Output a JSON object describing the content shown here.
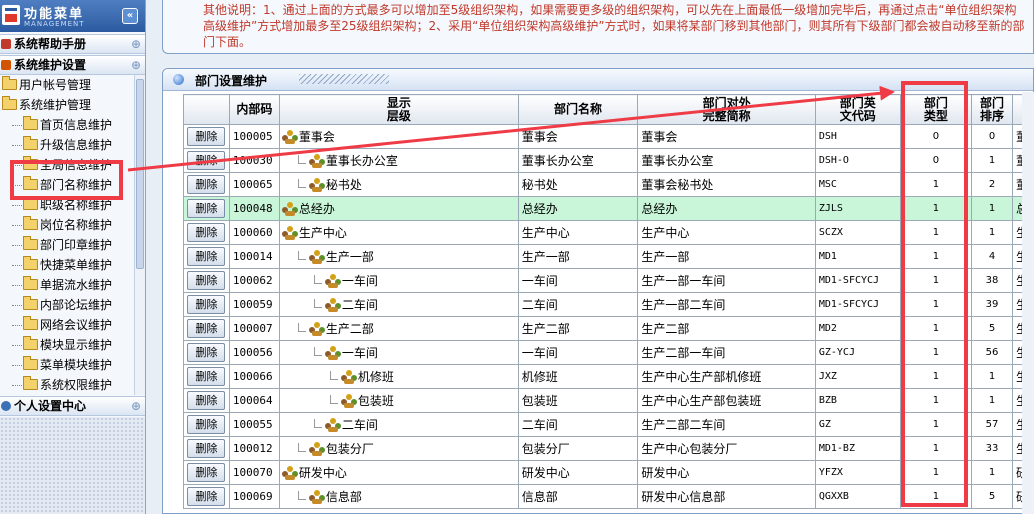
{
  "sidebar": {
    "title": "功能菜单",
    "subtitle": "MANAGEMENT",
    "collapse_glyph": "«",
    "sections": {
      "help": "系统帮助手册",
      "system": "系统维护设置",
      "personal": "个人设置中心"
    },
    "toggle_glyph": "⊕",
    "tree": [
      {
        "label": "用户帐号管理",
        "depth": 0
      },
      {
        "label": "系统维护管理",
        "depth": 0
      },
      {
        "label": "首页信息维护",
        "depth": 1
      },
      {
        "label": "升级信息维护",
        "depth": 1
      },
      {
        "label": "全局信息维护",
        "depth": 1
      },
      {
        "label": "部门名称维护",
        "depth": 1
      },
      {
        "label": "职级名称维护",
        "depth": 1
      },
      {
        "label": "岗位名称维护",
        "depth": 1
      },
      {
        "label": "部门印章维护",
        "depth": 1
      },
      {
        "label": "快捷菜单维护",
        "depth": 1
      },
      {
        "label": "单据流水维护",
        "depth": 1
      },
      {
        "label": "内部论坛维护",
        "depth": 1
      },
      {
        "label": "网络会议维护",
        "depth": 1
      },
      {
        "label": "模块显示维护",
        "depth": 1
      },
      {
        "label": "菜单模块维护",
        "depth": 1
      },
      {
        "label": "系统权限维护",
        "depth": 1
      }
    ]
  },
  "notice": {
    "label": "其他说明：",
    "text": "1、通过上面的方式最多可以增加至5级组织架构，如果需要更多级的组织架构，可以先在上面最低一级增加完毕后，再通过点击“单位组织架构高级维护”方式增加最多至25级组织架构；2、采用“单位组织架构高级维护”方式时，如果将某部门移到其他部门，则其所有下级部门都会被自动移至新的部门下面。"
  },
  "panel": {
    "title": "部门设置维护"
  },
  "table": {
    "headers": {
      "action": "",
      "id": "内部码",
      "level": "显示\n层级",
      "name": "部门名称",
      "fullname": "部门对外\n完整简称",
      "abbr": "部门英\n文代码",
      "type": "部门\n类型",
      "order": "部门\n排序",
      "extra": ""
    },
    "delete_label": "删除",
    "rows": [
      {
        "id": "100005",
        "level": "董事会",
        "depth": 0,
        "name": "董事会",
        "fullname": "董事会",
        "abbr": "DSH",
        "type": "0",
        "order": "0",
        "extra": "董"
      },
      {
        "id": "100030",
        "level": "董事长办公室",
        "depth": 1,
        "name": "董事长办公室",
        "fullname": "董事长办公室",
        "abbr": "DSH-O",
        "type": "0",
        "order": "1",
        "extra": "董"
      },
      {
        "id": "100065",
        "level": "秘书处",
        "depth": 1,
        "name": "秘书处",
        "fullname": "董事会秘书处",
        "abbr": "MSC",
        "type": "1",
        "order": "2",
        "extra": "董"
      },
      {
        "id": "100048",
        "level": "总经办",
        "depth": 0,
        "name": "总经办",
        "fullname": "总经办",
        "abbr": "ZJLS",
        "type": "1",
        "order": "1",
        "extra": "总",
        "selected": true
      },
      {
        "id": "100060",
        "level": "生产中心",
        "depth": 0,
        "name": "生产中心",
        "fullname": "生产中心",
        "abbr": "SCZX",
        "type": "1",
        "order": "1",
        "extra": "生"
      },
      {
        "id": "100014",
        "level": "生产一部",
        "depth": 1,
        "name": "生产一部",
        "fullname": "生产一部",
        "abbr": "MD1",
        "type": "1",
        "order": "4",
        "extra": "生"
      },
      {
        "id": "100062",
        "level": "一车间",
        "depth": 2,
        "name": "一车间",
        "fullname": "生产一部一车间",
        "abbr": "MD1-SFCYCJ",
        "type": "1",
        "order": "38",
        "extra": "生"
      },
      {
        "id": "100059",
        "level": "二车间",
        "depth": 2,
        "name": "二车间",
        "fullname": "生产一部二车间",
        "abbr": "MD1-SFCYCJ",
        "type": "1",
        "order": "39",
        "extra": "生"
      },
      {
        "id": "100007",
        "level": "生产二部",
        "depth": 1,
        "name": "生产二部",
        "fullname": "生产二部",
        "abbr": "MD2",
        "type": "1",
        "order": "5",
        "extra": "生"
      },
      {
        "id": "100056",
        "level": "一车间",
        "depth": 2,
        "name": "一车间",
        "fullname": "生产二部一车间",
        "abbr": "GZ-YCJ",
        "type": "1",
        "order": "56",
        "extra": "生"
      },
      {
        "id": "100066",
        "level": "机修班",
        "depth": 3,
        "name": "机修班",
        "fullname": "生产中心生产部机修班",
        "abbr": "JXZ",
        "type": "1",
        "order": "1",
        "extra": "生"
      },
      {
        "id": "100064",
        "level": "包装班",
        "depth": 3,
        "name": "包装班",
        "fullname": "生产中心生产部包装班",
        "abbr": "BZB",
        "type": "1",
        "order": "1",
        "extra": "生"
      },
      {
        "id": "100055",
        "level": "二车间",
        "depth": 2,
        "name": "二车间",
        "fullname": "生产二部二车间",
        "abbr": "GZ",
        "type": "1",
        "order": "57",
        "extra": "生"
      },
      {
        "id": "100012",
        "level": "包装分厂",
        "depth": 1,
        "name": "包装分厂",
        "fullname": "生产中心包装分厂",
        "abbr": "MD1-BZ",
        "type": "1",
        "order": "33",
        "extra": "生"
      },
      {
        "id": "100070",
        "level": "研发中心",
        "depth": 0,
        "name": "研发中心",
        "fullname": "研发中心",
        "abbr": "YFZX",
        "type": "1",
        "order": "1",
        "extra": "研"
      },
      {
        "id": "100069",
        "level": "信息部",
        "depth": 1,
        "name": "信息部",
        "fullname": "研发中心信息部",
        "abbr": "QGXXB",
        "type": "1",
        "order": "5",
        "extra": "研"
      }
    ]
  },
  "colors": {
    "highlight": "#ef3b46",
    "selected_row": "#c9f5d9",
    "notice_text": "#c0392b"
  }
}
